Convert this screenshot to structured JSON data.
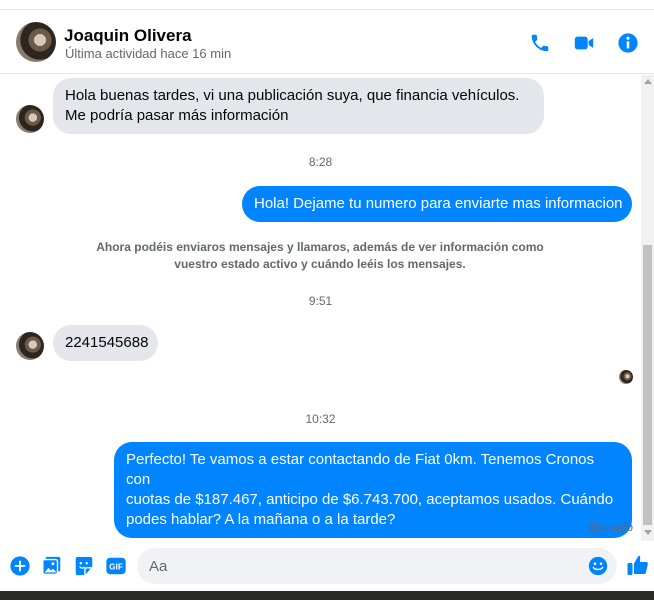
{
  "header": {
    "name": "Joaquin Olivera",
    "status": "Última actividad hace 16 min",
    "icons": [
      "phone-icon",
      "video-call-icon",
      "info-icon"
    ],
    "accent_color": "#0084ff"
  },
  "messages": [
    {
      "type": "incoming",
      "lines": [
        "Hola buenas tardes, vi una publicación suya, que financia vehículos.",
        "Me podría pasar más información"
      ]
    },
    {
      "type": "timestamp",
      "text": "8:28"
    },
    {
      "type": "outgoing",
      "lines": [
        "Hola! Dejame tu numero para enviarte mas informacion"
      ]
    },
    {
      "type": "system",
      "lines": [
        "Ahora podéis enviaros mensajes y llamaros, además de ver información como",
        "vuestro estado activo y cuándo leéis los mensajes."
      ]
    },
    {
      "type": "timestamp",
      "text": "9:51"
    },
    {
      "type": "incoming",
      "lines": [
        "2241545688"
      ]
    },
    {
      "type": "timestamp",
      "text": "10:32"
    },
    {
      "type": "outgoing",
      "lines": [
        "Perfecto! Te vamos a estar contactando de Fiat 0km. Tenemos Cronos con",
        "cuotas de $187.467, anticipo de $6.743.700, aceptamos usados. Cuándo",
        "podes hablar? A la mañana o a la tarde?"
      ]
    }
  ],
  "sent_status": "Enviado",
  "composer": {
    "placeholder": "Aa",
    "icons": [
      "add-icon",
      "photo-icon",
      "sticker-icon",
      "gif-icon",
      "emoji-icon",
      "like-icon"
    ],
    "gif_label": "GIF"
  },
  "colors": {
    "incoming_bubble": "#e4e6eb",
    "outgoing_bubble": "#0084ff",
    "secondary_text": "#65676b"
  }
}
